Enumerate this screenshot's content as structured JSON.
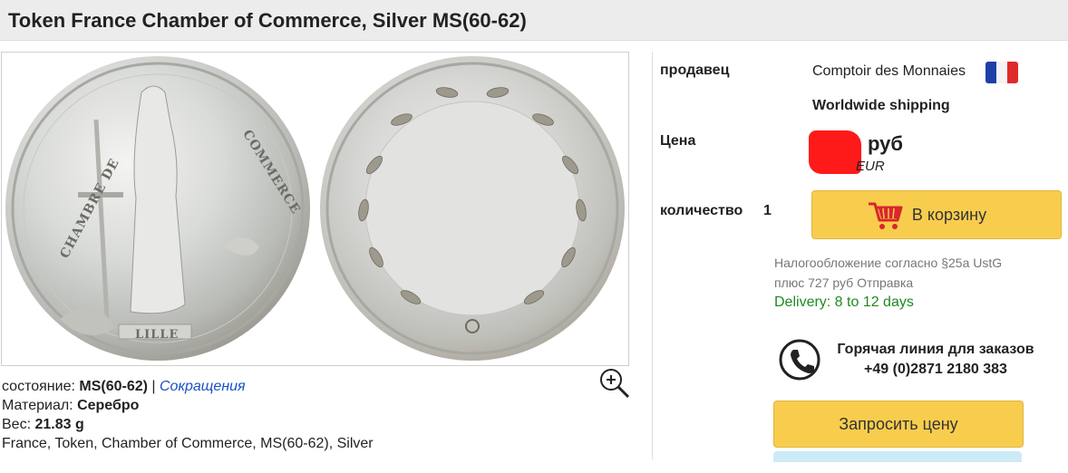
{
  "product": {
    "title": "Token France Chamber of Commerce, Silver MS(60-62)",
    "coin_obverse_text_left": "CHAMBRE DE",
    "coin_obverse_text_right": "COMMERCE",
    "coin_obverse_text_bottom": "LILLE"
  },
  "specs": {
    "condition_label": "состояние:",
    "condition_value": "MS(60-62)",
    "separator": "|",
    "abbrev_link": "Сокращения",
    "material_label": "Материал:",
    "material_value": "Серебро",
    "weight_label": "Вес:",
    "weight_value": "21.83 g",
    "description": "France, Token, Chamber of Commerce, MS(60-62), Silver"
  },
  "seller": {
    "label": "продавец",
    "name": "Comptoir des Monnaies",
    "flag": "france-flag",
    "shipping": "Worldwide shipping"
  },
  "price": {
    "label": "Цена",
    "currency_primary": "руб",
    "currency_secondary": "EUR"
  },
  "quantity": {
    "label": "количество",
    "value": "1"
  },
  "cart_button": {
    "label": "В корзину",
    "icon": "shopping-cart-icon"
  },
  "tax": {
    "line1": "Налогообложение согласно §25a UstG",
    "line2": "плюс 727 руб Отправка",
    "delivery": "Delivery: 8 to 12 days"
  },
  "hotline": {
    "icon": "phone-icon",
    "title": "Горячая линия для заказов",
    "number": "+49 (0)2871 2180 383"
  },
  "quote_button": {
    "label": "Запросить цену"
  },
  "colors": {
    "button": "#f8cd4e",
    "delivery": "#1f8a1f",
    "link": "#1a4fc4",
    "redaction": "#ff1a1a"
  }
}
